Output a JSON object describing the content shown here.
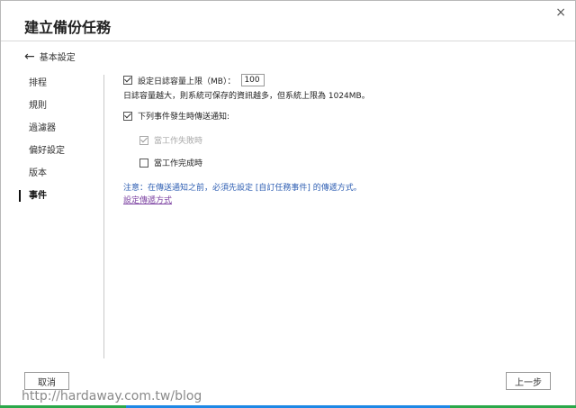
{
  "window": {
    "title": "建立備份任務",
    "close_label": "×"
  },
  "nav": {
    "back_label": "基本設定"
  },
  "sidebar": {
    "items": [
      {
        "label": "排程"
      },
      {
        "label": "規則"
      },
      {
        "label": "過濾器"
      },
      {
        "label": "偏好設定"
      },
      {
        "label": "版本"
      },
      {
        "label": "事件",
        "active": true
      }
    ]
  },
  "content": {
    "log_limit": {
      "checked": true,
      "label": "設定日誌容量上限（MB）：",
      "value": "100",
      "hint": "日誌容量越大，則系統可保存的資訊越多，但系統上限為 1024MB。"
    },
    "notify": {
      "checked": true,
      "label": "下列事件發生時傳送通知:",
      "options": [
        {
          "label": "當工作失敗時",
          "checked": true,
          "disabled": true
        },
        {
          "label": "當工作完成時",
          "checked": false,
          "disabled": false
        }
      ]
    },
    "note": "注意：在傳送通知之前，必須先設定 [自訂任務事件] 的傳遞方式。",
    "link": "設定傳遞方式"
  },
  "footer": {
    "cancel_label": "取消",
    "prev_label": "上一步"
  },
  "watermark": "http://hardaway.com.tw/blog",
  "colors": {
    "accent_green": "#2aa84a",
    "accent_blue": "#1e88e5",
    "note_blue": "#2f5fb3"
  }
}
